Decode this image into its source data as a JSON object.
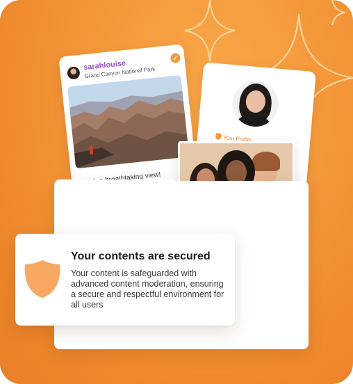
{
  "post": {
    "username": "sarahlouise",
    "location": "Grand Canyon National Park",
    "caption": "Such a breathtaking view!",
    "verified_glyph": "✓"
  },
  "profile": {
    "badge_text": "Your Profile"
  },
  "secure": {
    "title": "Your contents are secured",
    "description": "Your content is safeguarded with advanced content moderation, ensuring a secure and respectful environment for all users"
  },
  "colors": {
    "accent": "#f39a3a",
    "background": "#ef8a2e",
    "shield": "#f7a862",
    "username": "#9a54c2"
  },
  "icons": {
    "shield": "shield-icon",
    "sparkle": "sparkle-icon",
    "verified": "verified-icon"
  }
}
